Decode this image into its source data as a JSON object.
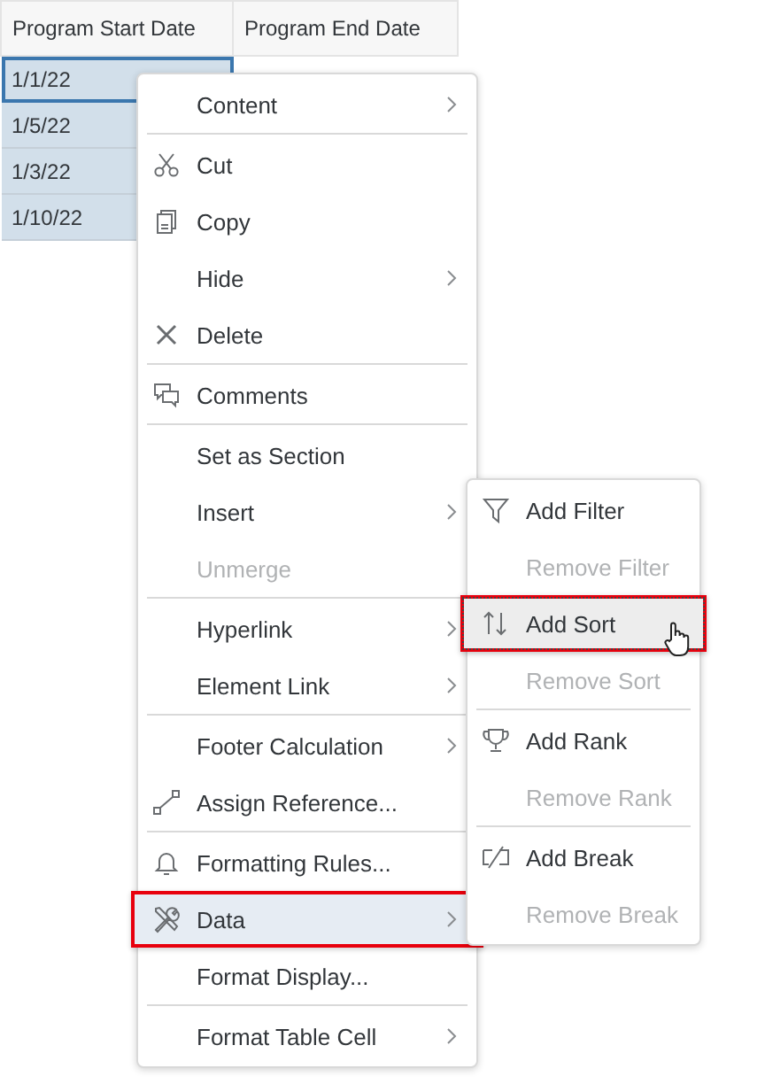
{
  "table": {
    "columns": [
      "Program Start Date",
      "Program End Date"
    ],
    "rows": [
      {
        "cells": [
          "1/1/22"
        ],
        "selected": true,
        "focused": true
      },
      {
        "cells": [
          "1/5/22"
        ],
        "selected": true,
        "focused": false
      },
      {
        "cells": [
          "1/3/22"
        ],
        "selected": true,
        "focused": false
      },
      {
        "cells": [
          "1/10/22"
        ],
        "selected": true,
        "focused": false
      }
    ]
  },
  "context_menu": {
    "items": [
      {
        "label": "Content",
        "kind": "plain",
        "submenu": true,
        "disabled": false,
        "selected": false,
        "separator_after": true
      },
      {
        "label": "Cut",
        "kind": "cut",
        "submenu": false,
        "disabled": false,
        "selected": false,
        "separator_after": false
      },
      {
        "label": "Copy",
        "kind": "copy",
        "submenu": false,
        "disabled": false,
        "selected": false,
        "separator_after": false
      },
      {
        "label": "Hide",
        "kind": "plain",
        "submenu": true,
        "disabled": false,
        "selected": false,
        "separator_after": false
      },
      {
        "label": "Delete",
        "kind": "delete",
        "submenu": false,
        "disabled": false,
        "selected": false,
        "separator_after": true
      },
      {
        "label": "Comments",
        "kind": "comments",
        "submenu": false,
        "disabled": false,
        "selected": false,
        "separator_after": true
      },
      {
        "label": "Set as Section",
        "kind": "plain",
        "submenu": false,
        "disabled": false,
        "selected": false,
        "separator_after": false
      },
      {
        "label": "Insert",
        "kind": "plain",
        "submenu": true,
        "disabled": false,
        "selected": false,
        "separator_after": false
      },
      {
        "label": "Unmerge",
        "kind": "plain",
        "submenu": false,
        "disabled": true,
        "selected": false,
        "separator_after": true
      },
      {
        "label": "Hyperlink",
        "kind": "plain",
        "submenu": true,
        "disabled": false,
        "selected": false,
        "separator_after": false
      },
      {
        "label": "Element Link",
        "kind": "plain",
        "submenu": true,
        "disabled": false,
        "selected": false,
        "separator_after": true
      },
      {
        "label": "Footer Calculation",
        "kind": "plain",
        "submenu": true,
        "disabled": false,
        "selected": false,
        "separator_after": false
      },
      {
        "label": "Assign Reference...",
        "kind": "reference",
        "submenu": false,
        "disabled": false,
        "selected": false,
        "separator_after": true
      },
      {
        "label": "Formatting Rules...",
        "kind": "bell",
        "submenu": false,
        "disabled": false,
        "selected": false,
        "separator_after": false
      },
      {
        "label": "Data",
        "kind": "tools",
        "submenu": true,
        "disabled": false,
        "selected": true,
        "outlined": true,
        "separator_after": false
      },
      {
        "label": "Format Display...",
        "kind": "plain",
        "submenu": false,
        "disabled": false,
        "selected": false,
        "separator_after": true
      },
      {
        "label": "Format Table Cell",
        "kind": "plain",
        "submenu": true,
        "disabled": false,
        "selected": false,
        "separator_after": false
      }
    ]
  },
  "data_submenu": {
    "items": [
      {
        "label": "Add Filter",
        "kind": "filter",
        "disabled": false,
        "selected": false,
        "separator_after": false
      },
      {
        "label": "Remove Filter",
        "kind": "plain",
        "disabled": true,
        "selected": false,
        "separator_after": false
      },
      {
        "label": "Add Sort",
        "kind": "sort",
        "disabled": false,
        "selected": true,
        "outlined": true,
        "cursor": true,
        "separator_after": false
      },
      {
        "label": "Remove Sort",
        "kind": "plain",
        "disabled": true,
        "selected": false,
        "separator_after": true
      },
      {
        "label": "Add Rank",
        "kind": "rank",
        "disabled": false,
        "selected": false,
        "separator_after": false
      },
      {
        "label": "Remove Rank",
        "kind": "plain",
        "disabled": true,
        "selected": false,
        "separator_after": true
      },
      {
        "label": "Add Break",
        "kind": "break",
        "disabled": false,
        "selected": false,
        "separator_after": false
      },
      {
        "label": "Remove Break",
        "kind": "plain",
        "disabled": true,
        "selected": false,
        "separator_after": false
      }
    ]
  }
}
